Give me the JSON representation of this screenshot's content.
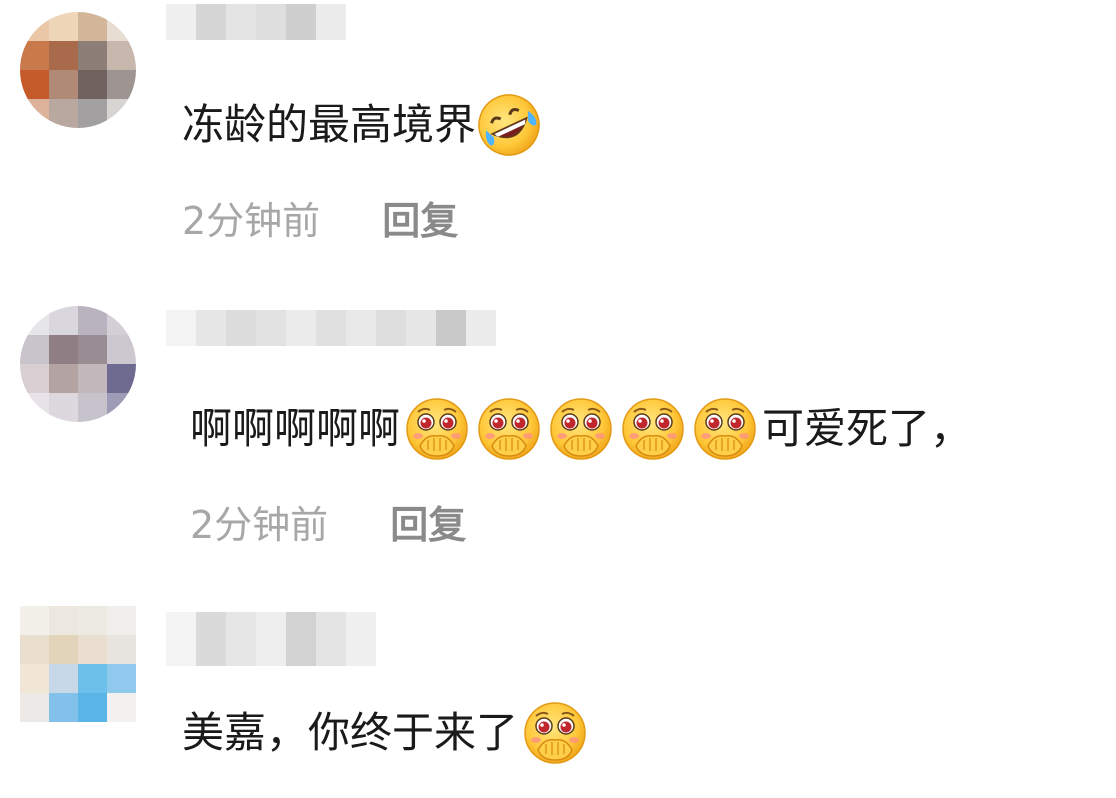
{
  "comments": [
    {
      "text_before": "冻龄的最高境界",
      "emoji": "rolling-on-floor-laughing-icon",
      "text_after": "",
      "time": "2分钟前",
      "reply_label": "回复"
    },
    {
      "text_before": "啊啊啊啊啊",
      "emoji": "pleading-face-hand-over-mouth-icon",
      "emoji_count": 5,
      "text_after": "可爱死了，",
      "time": "2分钟前",
      "reply_label": "回复"
    },
    {
      "text_before": "美嘉，你终于来了",
      "emoji": "pleading-face-hand-over-mouth-icon",
      "text_after": ""
    }
  ],
  "colors": {
    "text": "#1a1a1a",
    "time": "#a7a7a7",
    "reply": "#8a8a8a",
    "background": "#ffffff"
  }
}
